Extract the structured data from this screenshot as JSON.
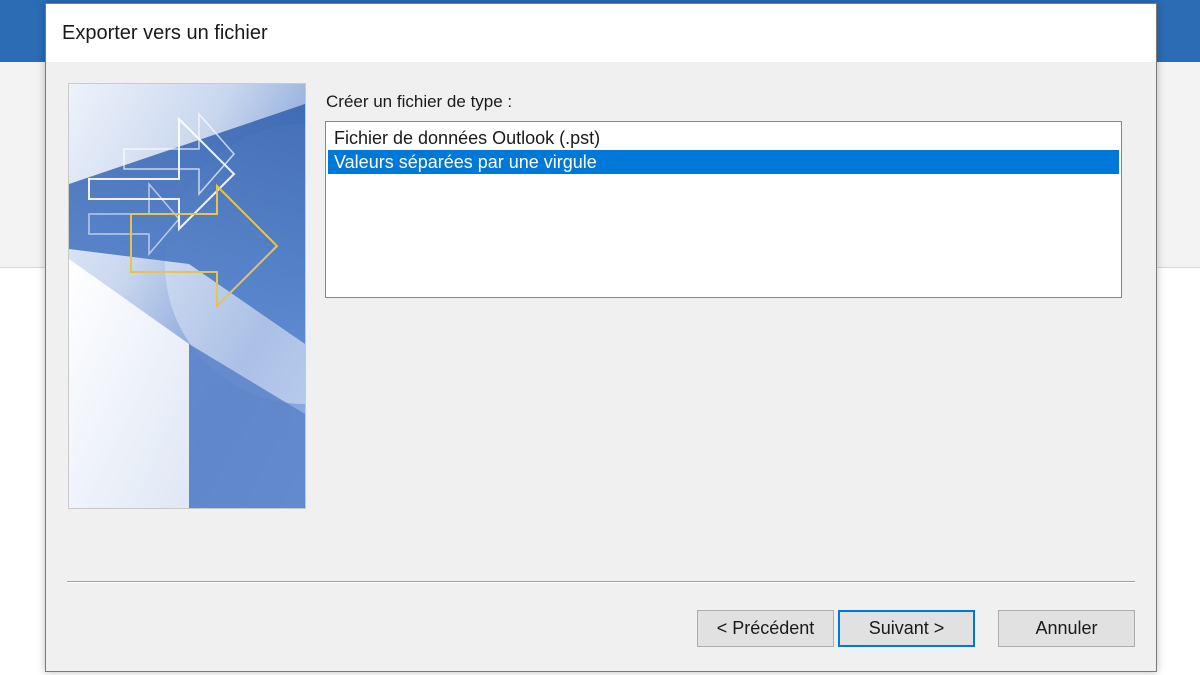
{
  "dialog": {
    "title": "Exporter vers un fichier",
    "prompt": "Créer un fichier de type :",
    "file_types": [
      {
        "label": "Fichier de données Outlook (.pst)",
        "selected": false
      },
      {
        "label": "Valeurs séparées par une virgule",
        "selected": true
      }
    ],
    "buttons": {
      "back": "< Précédent",
      "next": "Suivant >",
      "cancel": "Annuler"
    }
  },
  "colors": {
    "accent": "#0078d7",
    "titlebar_blue": "#2b6cb5",
    "dialog_bg": "#f0f0f0",
    "button_bg": "#e1e1e1",
    "arrow_gold": "#e8c547"
  },
  "icons": {
    "wizard_graphic": "export-arrows-graphic"
  }
}
